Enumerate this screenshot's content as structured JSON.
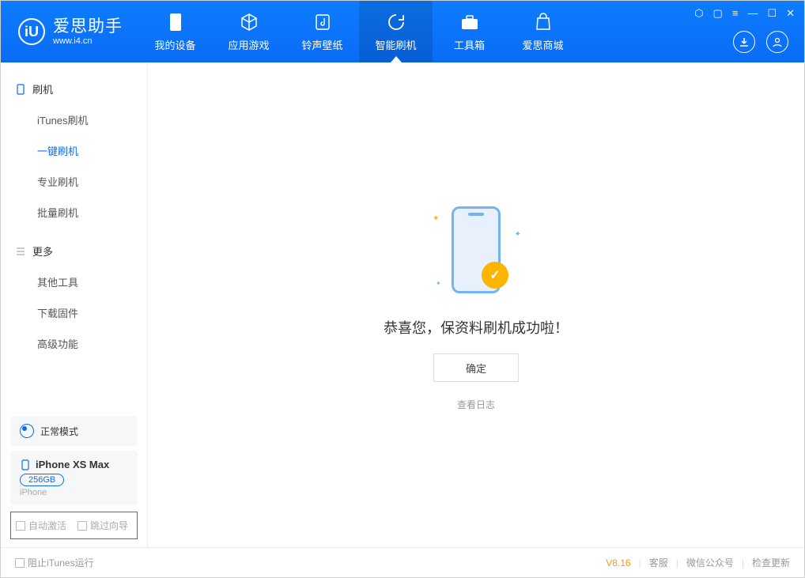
{
  "header": {
    "logo_cn": "爱思助手",
    "logo_url": "www.i4.cn",
    "nav": [
      "我的设备",
      "应用游戏",
      "铃声壁纸",
      "智能刷机",
      "工具箱",
      "爱思商城"
    ]
  },
  "sidebar": {
    "section1": "刷机",
    "items1": [
      "iTunes刷机",
      "一键刷机",
      "专业刷机",
      "批量刷机"
    ],
    "section2": "更多",
    "items2": [
      "其他工具",
      "下载固件",
      "高级功能"
    ],
    "mode_label": "正常模式",
    "device": {
      "name": "iPhone XS Max",
      "storage": "256GB",
      "type": "iPhone"
    },
    "chk1": "自动激活",
    "chk2": "跳过向导"
  },
  "main": {
    "message": "恭喜您，保资料刷机成功啦！",
    "ok": "确定",
    "log": "查看日志"
  },
  "footer": {
    "block_itunes": "阻止iTunes运行",
    "version": "V8.16",
    "links": [
      "客服",
      "微信公众号",
      "检查更新"
    ]
  }
}
